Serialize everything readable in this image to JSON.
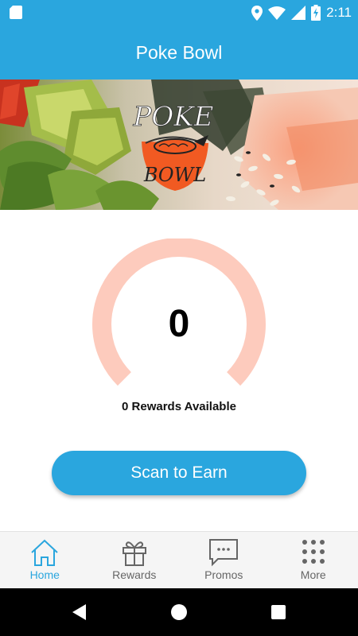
{
  "status_bar": {
    "time": "2:11",
    "icons": [
      "sd-card-icon",
      "location-icon",
      "wifi-icon",
      "signal-icon",
      "battery-charging-icon"
    ]
  },
  "app_bar": {
    "title": "Poke Bowl"
  },
  "hero": {
    "logo_top": "POKE",
    "logo_bottom": "BOWL"
  },
  "rewards": {
    "points": "0",
    "available_text": "0 Rewards Available",
    "progress_fraction": 0
  },
  "actions": {
    "scan_label": "Scan to Earn"
  },
  "tabs": [
    {
      "label": "Home",
      "icon": "home-icon",
      "active": true
    },
    {
      "label": "Rewards",
      "icon": "gift-icon",
      "active": false
    },
    {
      "label": "Promos",
      "icon": "chat-icon",
      "active": false
    },
    {
      "label": "More",
      "icon": "grid-icon",
      "active": false
    }
  ],
  "colors": {
    "primary": "#2aa6de",
    "gauge_track": "#fdcbbd",
    "logo_orange": "#f15a22",
    "inactive": "#666666"
  }
}
